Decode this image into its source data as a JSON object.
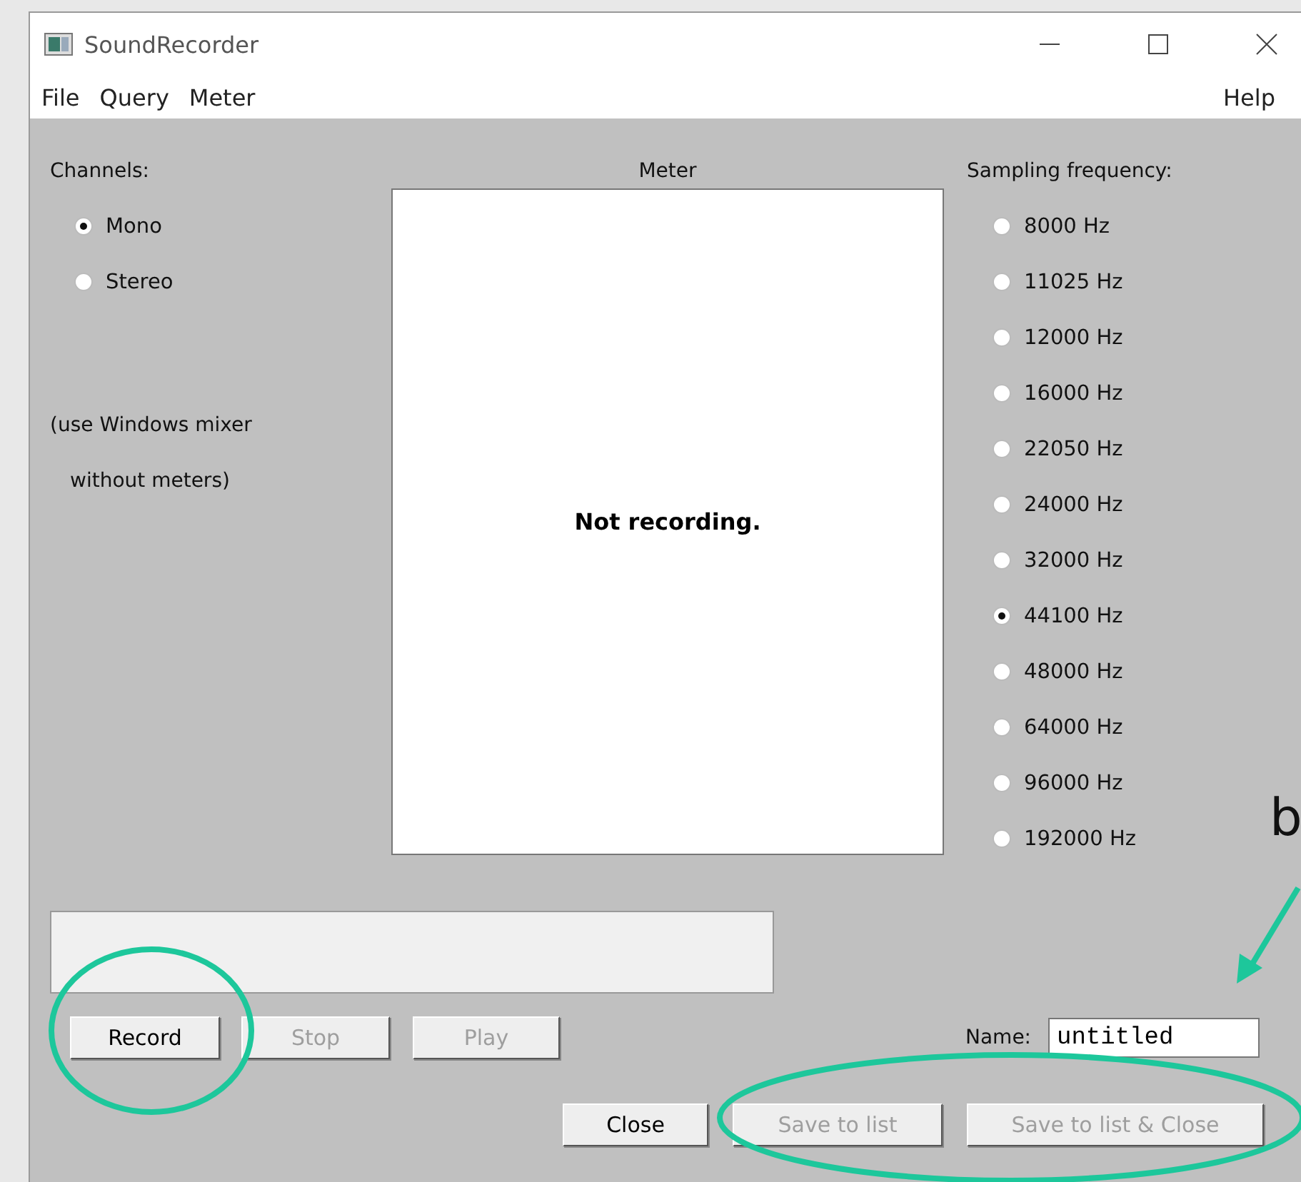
{
  "window": {
    "title": "SoundRecorder"
  },
  "menu": [
    {
      "label": "File"
    },
    {
      "label": "Query"
    },
    {
      "label": "Meter"
    }
  ],
  "help_menu": {
    "label": "Help"
  },
  "channels": {
    "label": "Channels:",
    "options": [
      {
        "label": "Mono",
        "selected": true
      },
      {
        "label": "Stereo",
        "selected": false
      }
    ],
    "note_lines": [
      "(use Windows mixer",
      "without meters)"
    ]
  },
  "meter": {
    "label": "Meter",
    "status": "Not recording."
  },
  "sampling": {
    "label": "Sampling frequency:",
    "options": [
      {
        "label": "8000 Hz",
        "selected": false
      },
      {
        "label": "11025 Hz",
        "selected": false
      },
      {
        "label": "12000 Hz",
        "selected": false
      },
      {
        "label": "16000 Hz",
        "selected": false
      },
      {
        "label": "22050 Hz",
        "selected": false
      },
      {
        "label": "24000 Hz",
        "selected": false
      },
      {
        "label": "32000 Hz",
        "selected": false
      },
      {
        "label": "44100 Hz",
        "selected": true
      },
      {
        "label": "48000 Hz",
        "selected": false
      },
      {
        "label": "64000 Hz",
        "selected": false
      },
      {
        "label": "96000 Hz",
        "selected": false
      },
      {
        "label": "192000 Hz",
        "selected": false
      }
    ]
  },
  "transport_buttons": [
    {
      "label": "Record",
      "disabled": false
    },
    {
      "label": "Stop",
      "disabled": true
    },
    {
      "label": "Play",
      "disabled": true
    }
  ],
  "name_field": {
    "label": "Name:",
    "value": "untitled"
  },
  "bottom_buttons": [
    {
      "label": "Close",
      "disabled": false
    },
    {
      "label": "Save to list",
      "disabled": true
    },
    {
      "label": "Save to list & Close",
      "disabled": true
    }
  ],
  "annotation": {
    "label": "b"
  }
}
